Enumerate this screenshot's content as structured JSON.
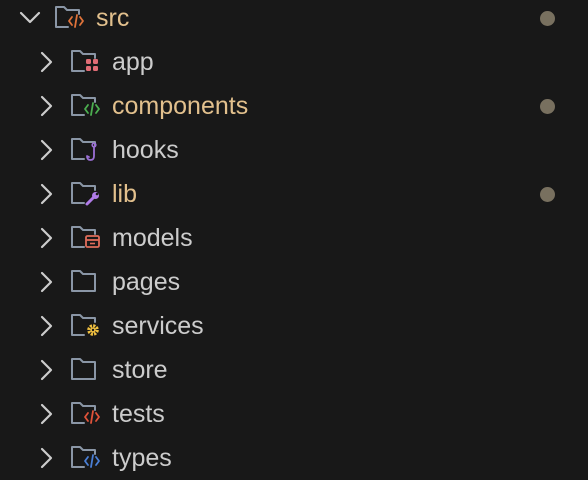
{
  "explorer": {
    "root": {
      "label": "src",
      "expanded": true,
      "modified": true,
      "icon": "folder-src-icon",
      "badge_color": "#e0733a"
    },
    "children": [
      {
        "label": "app",
        "icon": "folder-app-icon",
        "modified": false,
        "badge_color": "#e06c75"
      },
      {
        "label": "components",
        "icon": "folder-components-icon",
        "modified": true,
        "badge_color": "#4caf50"
      },
      {
        "label": "hooks",
        "icon": "folder-hooks-icon",
        "modified": false,
        "badge_color": "#9b6fd6"
      },
      {
        "label": "lib",
        "icon": "folder-lib-icon",
        "modified": true,
        "badge_color": "#b07ce8"
      },
      {
        "label": "models",
        "icon": "folder-models-icon",
        "modified": false,
        "badge_color": "#e06c5a"
      },
      {
        "label": "pages",
        "icon": "folder-pages-icon",
        "modified": false,
        "badge_color": ""
      },
      {
        "label": "services",
        "icon": "folder-services-icon",
        "modified": false,
        "badge_color": "#f0c040"
      },
      {
        "label": "store",
        "icon": "folder-store-icon",
        "modified": false,
        "badge_color": ""
      },
      {
        "label": "tests",
        "icon": "folder-tests-icon",
        "modified": false,
        "badge_color": "#e0533a"
      },
      {
        "label": "types",
        "icon": "folder-types-icon",
        "modified": false,
        "badge_color": "#4a7fd6"
      }
    ],
    "colors": {
      "background": "#181818",
      "text": "#cccccc",
      "modified_text": "#e2c08d",
      "modified_dot": "#78705f",
      "folder_outline": "#8a96a6",
      "chevron": "#cccccc"
    }
  }
}
